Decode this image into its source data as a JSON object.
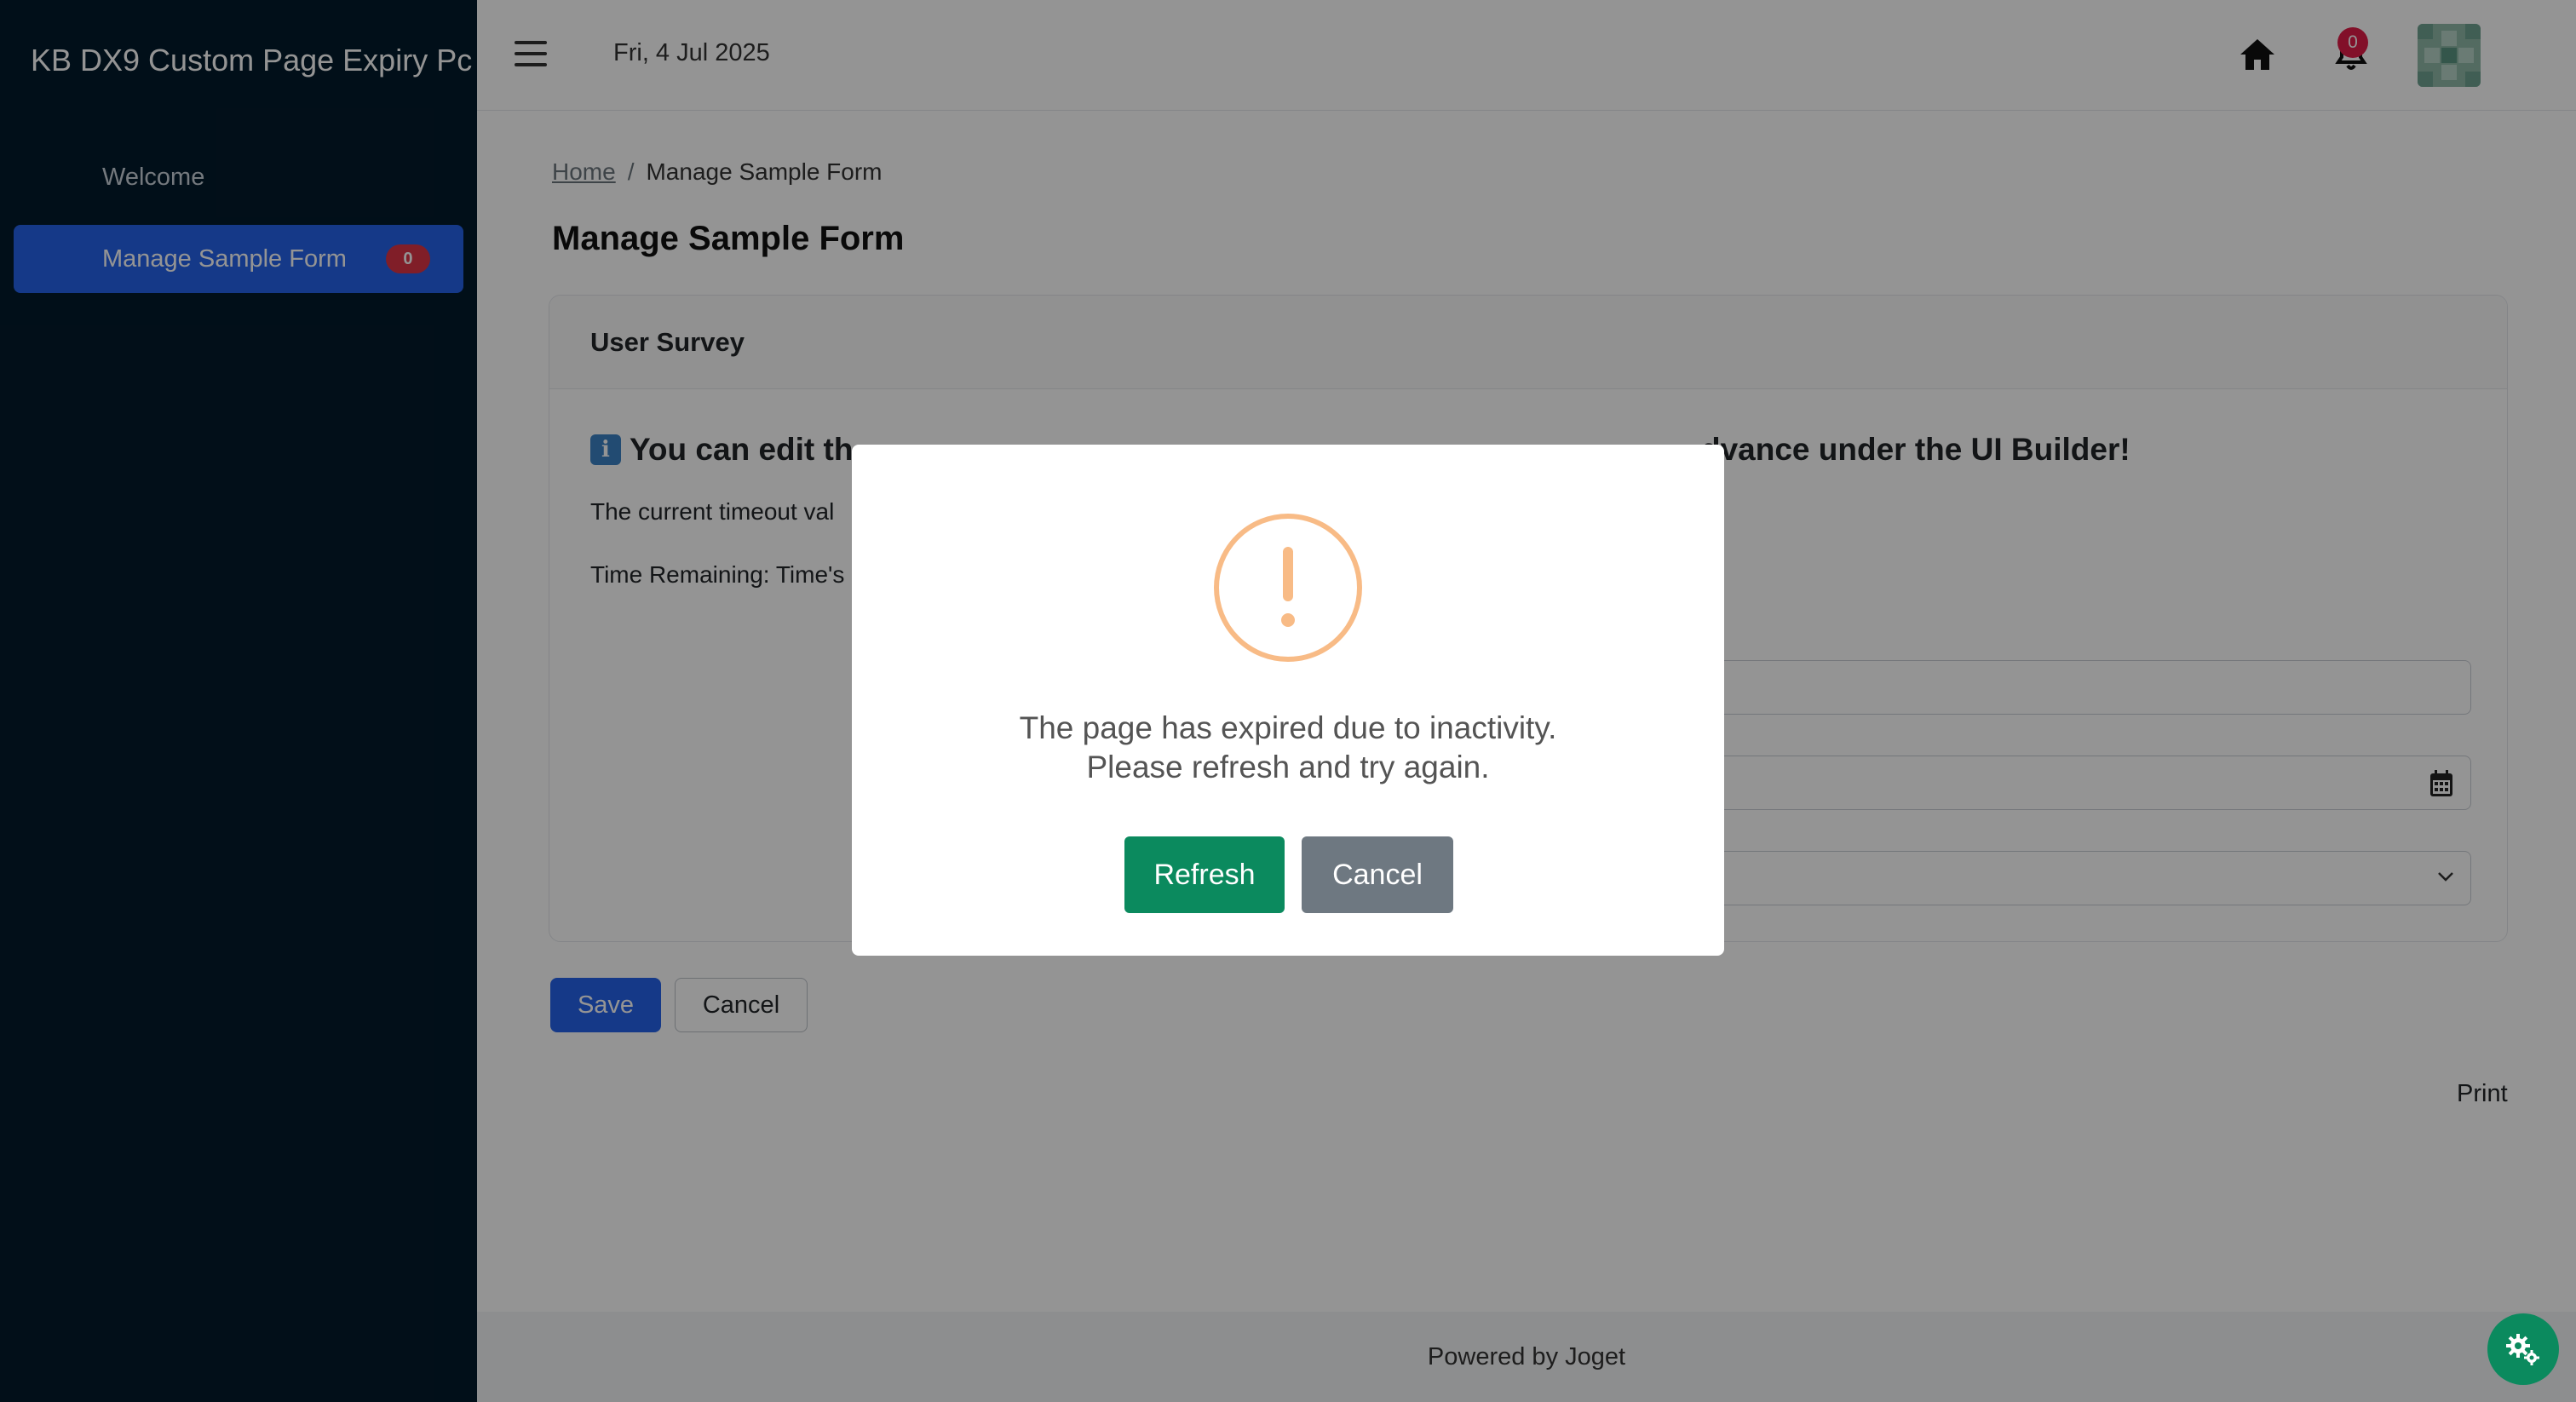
{
  "app": {
    "title": "KB DX9 Custom Page Expiry Pc"
  },
  "sidebar": {
    "items": [
      {
        "label": "Welcome"
      },
      {
        "label": "Manage Sample Form",
        "badge": "0"
      }
    ]
  },
  "header": {
    "date": "Fri, 4 Jul 2025",
    "notification_count": "0",
    "icons": [
      "menu-icon",
      "home-icon",
      "bell-icon",
      "avatar"
    ]
  },
  "breadcrumb": {
    "home": "Home",
    "separator": "/",
    "current": "Manage Sample Form"
  },
  "page": {
    "title": "Manage Sample Form"
  },
  "form": {
    "card_title": "User Survey",
    "info_text_left": "You can edit th",
    "info_text_right_bold": "dvance",
    "info_text_right": " under the UI Builder!",
    "timeout_text": "The current timeout val",
    "remaining_text": "Time Remaining: Time's"
  },
  "buttons": {
    "save": "Save",
    "cancel": "Cancel"
  },
  "print_label": "Print",
  "footer": {
    "text": "Powered by Joget"
  },
  "modal": {
    "message_line1": "The page has expired due to inactivity.",
    "message_line2": "Please refresh and try again.",
    "refresh_label": "Refresh",
    "cancel_label": "Cancel"
  },
  "colors": {
    "sidebar_bg": "#031a2b",
    "accent": "#2563eb",
    "warning": "#f8bb86",
    "success": "#0b8a5e",
    "secondary": "#6e7881",
    "badge": "#dc3545"
  }
}
